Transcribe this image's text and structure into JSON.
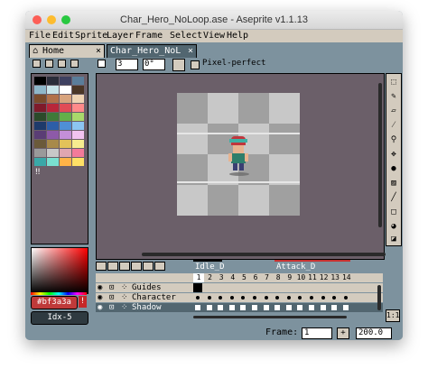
{
  "window": {
    "title": "Char_Hero_NoLoop.ase - Aseprite v1.1.13"
  },
  "menu": [
    "File",
    "Edit",
    "Sprite",
    "Layer",
    "Frame",
    "Select",
    "View",
    "Help"
  ],
  "tabs": [
    {
      "label": "Home",
      "close": "×"
    },
    {
      "label": "Char_Hero_NoL",
      "close": "×"
    }
  ],
  "context_bar": {
    "size_value": "3",
    "angle_value": "0°",
    "pixel_perfect_label": "Pixel-perfect"
  },
  "palette": {
    "colors": [
      "#000000",
      "#2b2d3a",
      "#3e4060",
      "#5a7d9a",
      "#8fb7c9",
      "#c8e3e8",
      "#ffffff",
      "#4a3626",
      "#7a4b2b",
      "#b2714a",
      "#d8a37d",
      "#efd3b3",
      "#7f1a2a",
      "#b8263a",
      "#e14b56",
      "#ff8a8a",
      "#2b4a2a",
      "#3e7a39",
      "#63b04a",
      "#a9d96b",
      "#1e3a6b",
      "#2d5ea8",
      "#4f8fd6",
      "#8cc5f2",
      "#5a3d75",
      "#8d5aa8",
      "#c48fd8",
      "#f2c3f0",
      "#6b5a3a",
      "#a88a4a",
      "#e3c25a",
      "#f7ec8f",
      "#9a9a9a",
      "#c8c8c8",
      "#e0a6b0",
      "#f27a9a",
      "#3aa8a8",
      "#7ae0d0",
      "#ffb347",
      "#ffe066"
    ],
    "page_marker": "‼"
  },
  "color_panel": {
    "fg_hex": "#bf3a3a",
    "warning": "!",
    "bg_index": "Idx-5"
  },
  "timeline": {
    "tags": [
      {
        "label": "Idle_D",
        "color": "#000000"
      },
      {
        "label": "Attack_D",
        "color": "#c8302f"
      }
    ],
    "layers": [
      "Guides",
      "Character",
      "Shadow"
    ],
    "frame_numbers": [
      "1",
      "2",
      "3",
      "4",
      "5",
      "6",
      "7",
      "8",
      "9",
      "10",
      "11",
      "12",
      "13",
      "14"
    ]
  },
  "status": {
    "frame_label": "Frame:",
    "frame_value": "1",
    "add_label": "+",
    "zoom_value": "200.0"
  }
}
